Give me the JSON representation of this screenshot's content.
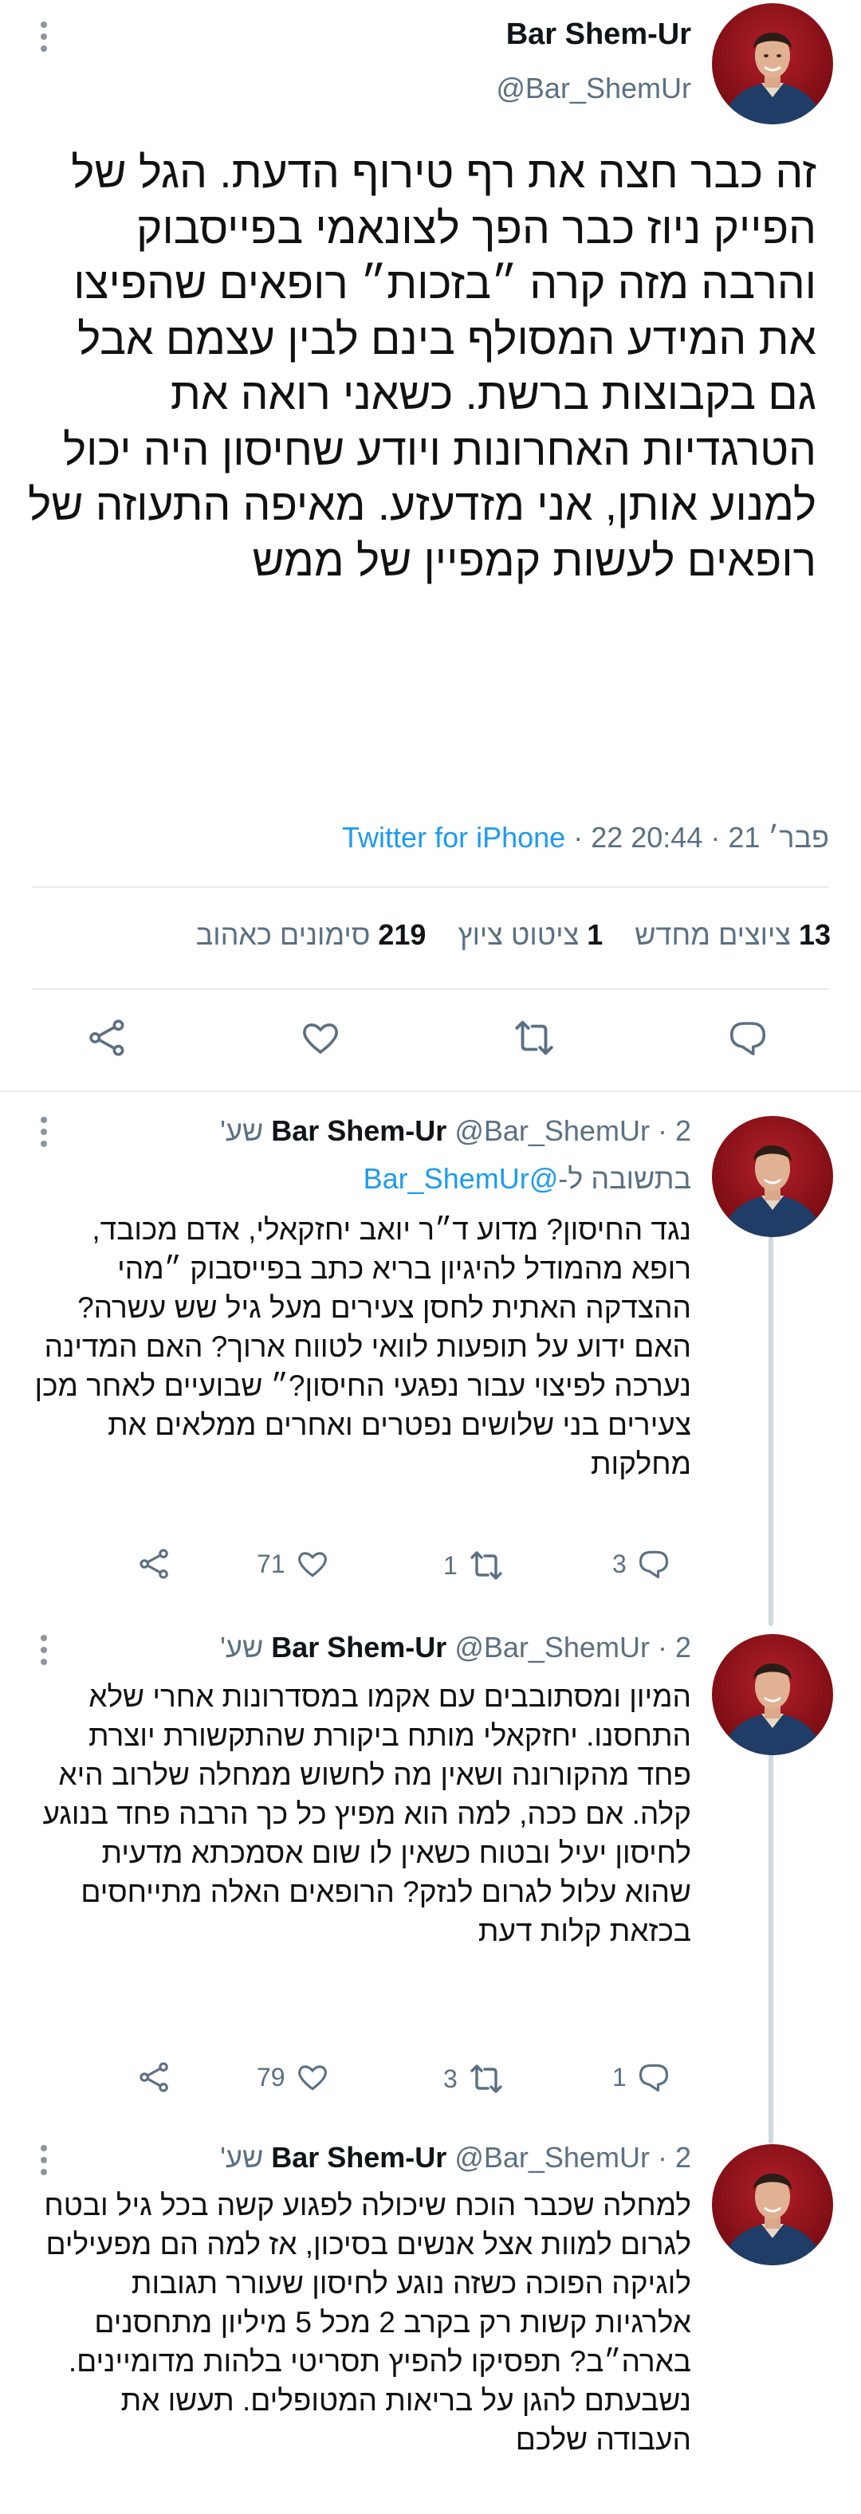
{
  "tweet": {
    "author_name": "Bar Shem-Ur",
    "author_handle": "@Bar_ShemUr",
    "text": "זה כבר חצה את רף טירוף הדעת. הגל של הפייק ניוז כבר הפך לצונאמי בפייסבוק והרבה מזה קרה ״בזכות״ רופאים שהפיצו את המידע המסולף בינם לבין עצמם אבל גם בקבוצות ברשת. כשאני רואה את הטרגדיות האחרונות ויודע שחיסון היה יכול למנוע אותן, אני מזדעזע. מאיפה התעוזה של רופאים לעשות קמפיין של ממש",
    "time": "20:44",
    "date": "22 פבר׳ 21",
    "source": "Twitter for iPhone",
    "separator": "·",
    "stats": {
      "retweets_count": "13",
      "retweets_label": "ציוצים מחדש",
      "quotes_count": "1",
      "quotes_label": "ציטוט ציוץ",
      "likes_count": "219",
      "likes_label": "סימונים כאהוב"
    },
    "actions": [
      "reply-icon",
      "retweet-icon",
      "like-icon",
      "share-icon"
    ]
  },
  "replies": [
    {
      "author_name": "Bar Shem-Ur",
      "author_handle": "@Bar_ShemUr",
      "time_ago": "2 שע'",
      "replying_prefix": "בתשובה ל-",
      "replying_to": "@Bar_ShemUr",
      "text": "נגד החיסון? מדוע ד״ר יואב יחזקאלי, אדם מכובד, רופא מהמודל להיגיון בריא כתב בפייסבוק ״מהי ההצדקה האתית לחסן צעירים מעל גיל שש עשרה? האם ידוע על תופעות לוואי לטווח ארוך? האם המדינה נערכה לפיצוי עבור נפגעי החיסון?״ שבועיים לאחר מכן צעירים בני שלושים נפטרים ואחרים ממלאים את מחלקות",
      "reply_count": "3",
      "retweet_count": "1",
      "like_count": "71"
    },
    {
      "author_name": "Bar Shem-Ur",
      "author_handle": "@Bar_ShemUr",
      "time_ago": "2 שע'",
      "text": "המיון ומסתובבים עם אקמו במסדרונות אחרי שלא התחסנו. יחזקאלי מותח ביקורת שהתקשורת יוצרת פחד מהקורונה ושאין מה לחשוש ממחלה שלרוב היא קלה. אם ככה, למה הוא מפיץ כל כך הרבה פחד בנוגע לחיסון יעיל ובטוח כשאין לו שום אסמכתא מדעית שהוא עלול לגרום לנזק? הרופאים האלה מתייחסים בכזאת קלות דעת",
      "reply_count": "1",
      "retweet_count": "3",
      "like_count": "79"
    },
    {
      "author_name": "Bar Shem-Ur",
      "author_handle": "@Bar_ShemUr",
      "time_ago": "2 שע'",
      "text": "למחלה שכבר הוכח שיכולה לפגוע קשה בכל גיל ובטח לגרום למוות אצל אנשים בסיכון, אז למה הם מפעילים לוגיקה הפוכה כשזה נוגע לחיסון שעורר תגובות אלרגיות קשות רק בקרב 2 מכל 5 מיליון מתחסנים בארה״ב? תפסיקו להפיץ תסריטי בלהות מדומיינים. נשבעתם להגן על בריאות המטופלים. תעשו את העבודה שלכם"
    }
  ],
  "colors": {
    "link": "#1d9bf0",
    "secondary_text": "#5b7083",
    "divider": "#e6ecf0",
    "thread_line": "#cfd9de",
    "avatar_bg": "#9e1620"
  }
}
